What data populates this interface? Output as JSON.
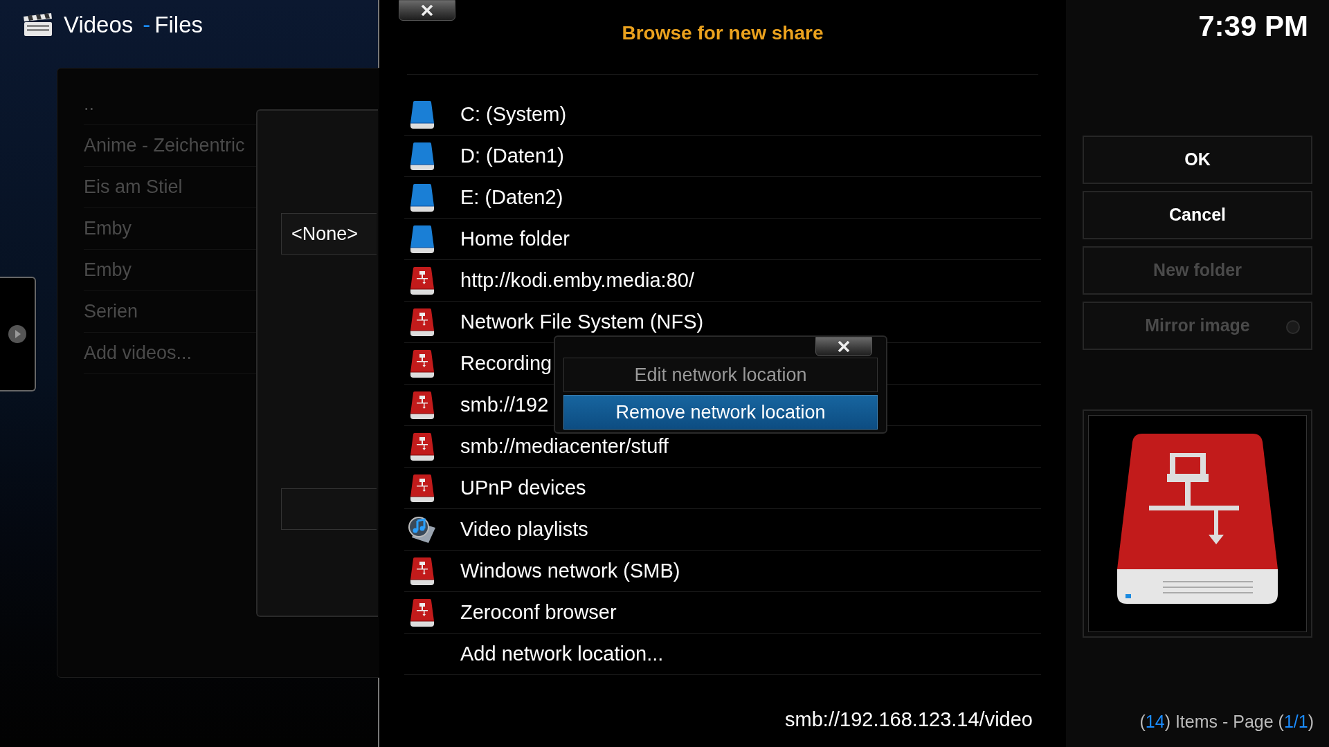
{
  "header": {
    "section": "Videos",
    "separator": "-",
    "view": "Files"
  },
  "clock": "7:39 PM",
  "sources": [
    "..",
    "Anime - Zeichentric",
    "Eis am Stiel",
    "Emby",
    "Emby",
    "Serien",
    "Add videos..."
  ],
  "source_dialog": {
    "content_type": "<None>"
  },
  "browse_dialog": {
    "title": "Browse for new share",
    "items": [
      {
        "label": "C: (System)",
        "kind": "drive"
      },
      {
        "label": "D: (Daten1)",
        "kind": "drive"
      },
      {
        "label": "E: (Daten2)",
        "kind": "drive"
      },
      {
        "label": "Home folder",
        "kind": "drive"
      },
      {
        "label": "http://kodi.emby.media:80/",
        "kind": "network"
      },
      {
        "label": "Network File System (NFS)",
        "kind": "network"
      },
      {
        "label": "Recording",
        "kind": "network"
      },
      {
        "label": "smb://192",
        "kind": "network"
      },
      {
        "label": "smb://mediacenter/stuff",
        "kind": "network"
      },
      {
        "label": "UPnP devices",
        "kind": "network"
      },
      {
        "label": "Video playlists",
        "kind": "playlist"
      },
      {
        "label": "Windows network (SMB)",
        "kind": "network"
      },
      {
        "label": "Zeroconf browser",
        "kind": "network"
      },
      {
        "label": "Add network location...",
        "kind": "plain"
      }
    ],
    "path": "smb://192.168.123.14/video"
  },
  "context_menu": {
    "items": [
      {
        "label": "Edit network location",
        "selected": false
      },
      {
        "label": "Remove network location",
        "selected": true
      }
    ]
  },
  "side_buttons": [
    {
      "label": "OK",
      "kind": "button",
      "disabled": false
    },
    {
      "label": "Cancel",
      "kind": "button",
      "disabled": false
    },
    {
      "label": "New folder",
      "kind": "button",
      "disabled": true
    },
    {
      "label": "Mirror image",
      "kind": "toggle",
      "disabled": true,
      "on": false
    }
  ],
  "footer": [
    {
      "text": "(",
      "accent": false
    },
    {
      "text": "14",
      "accent": true
    },
    {
      "text": ") Items - Page (",
      "accent": false
    },
    {
      "text": "1/1",
      "accent": true
    },
    {
      "text": ")",
      "accent": false
    }
  ]
}
